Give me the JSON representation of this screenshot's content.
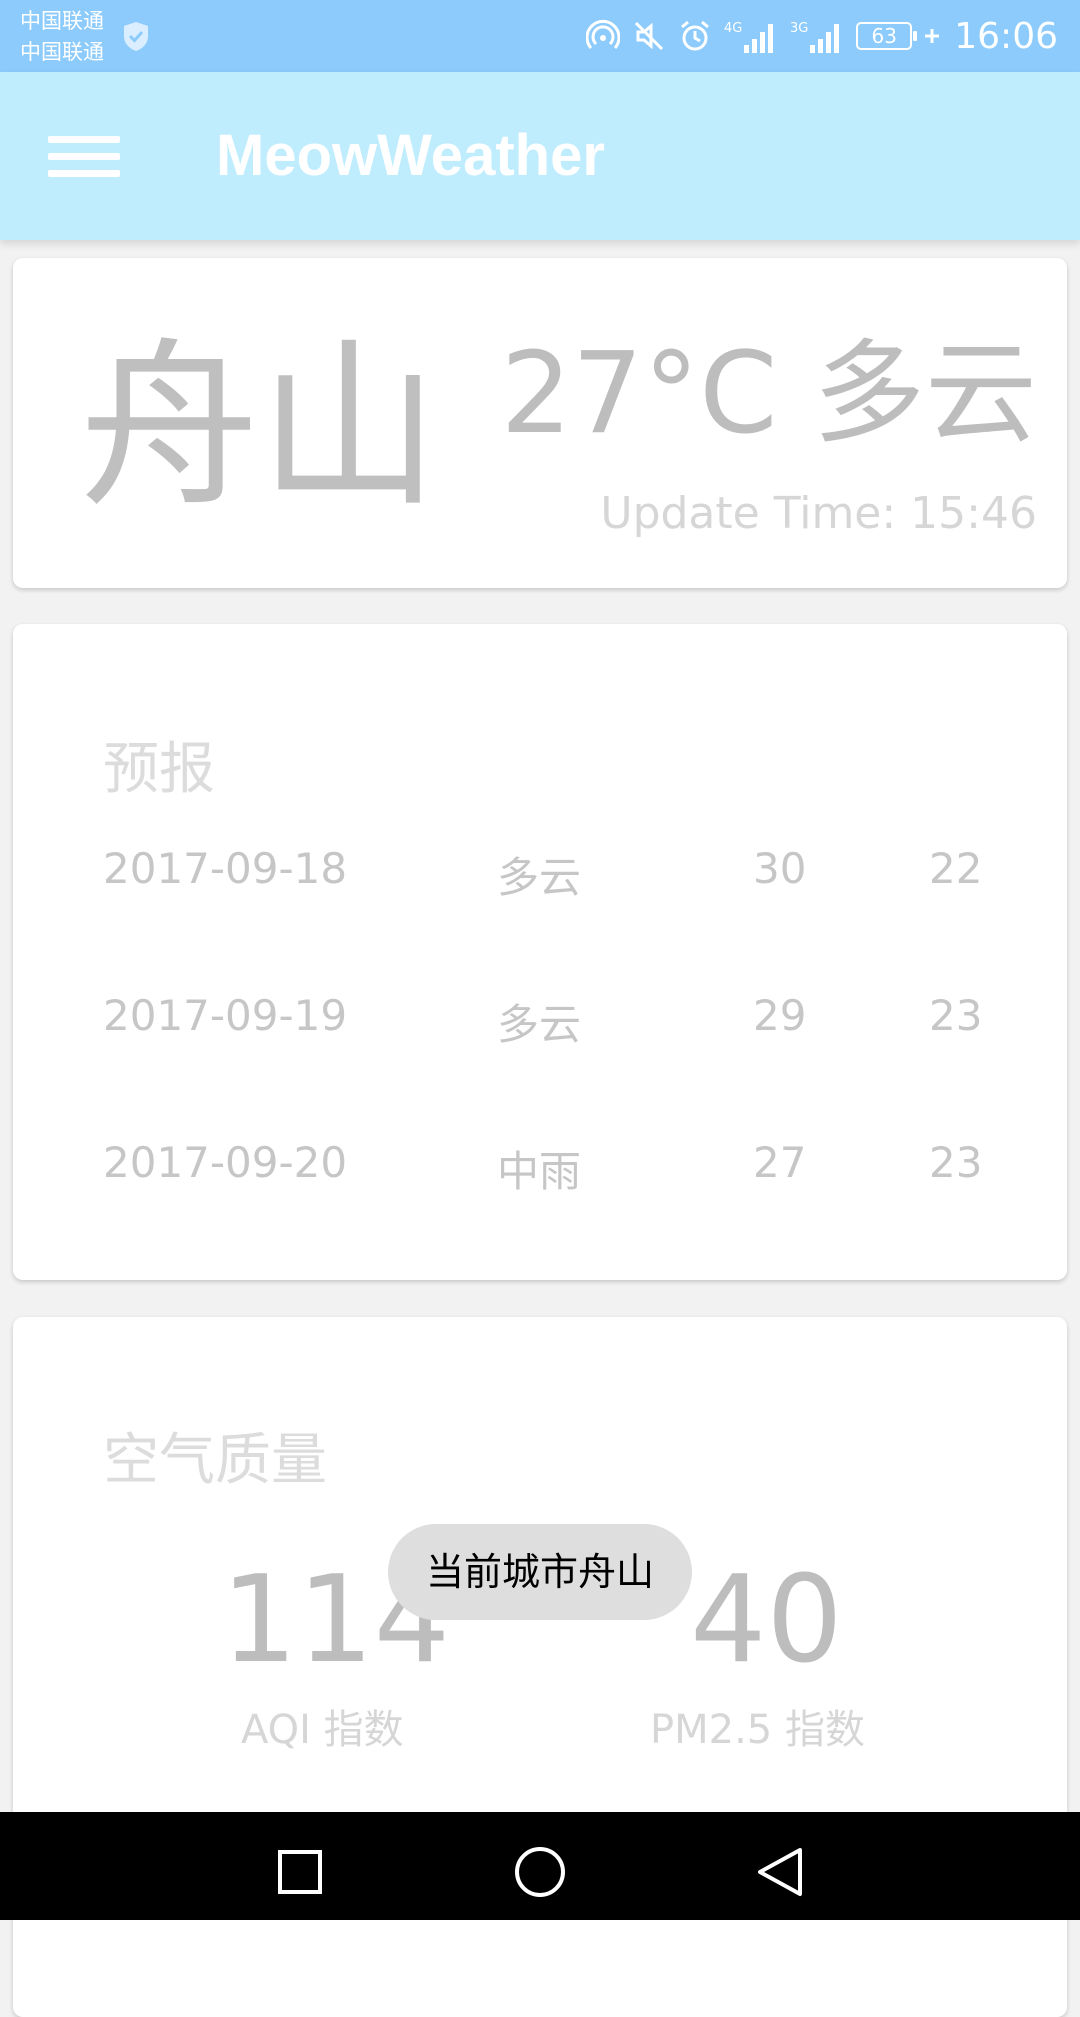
{
  "status_bar": {
    "carrier_1": "中国联通",
    "carrier_2": "中国联通",
    "network_1": "4G",
    "network_2": "3G",
    "battery": "63",
    "time": "16:06"
  },
  "app_bar": {
    "title": "MeowWeather",
    "menu_icon": "menu-icon"
  },
  "current": {
    "city": "舟山",
    "temperature": "27°C",
    "condition": "多云",
    "update_time": "Update Time: 15:46"
  },
  "forecast": {
    "title": "预报",
    "rows": [
      {
        "date": "2017-09-18",
        "condition": "多云",
        "max": "30",
        "min": "22"
      },
      {
        "date": "2017-09-19",
        "condition": "多云",
        "max": "29",
        "min": "23"
      },
      {
        "date": "2017-09-20",
        "condition": "中雨",
        "max": "27",
        "min": "23"
      }
    ]
  },
  "air_quality": {
    "title": "空气质量",
    "aqi_value": "114",
    "aqi_label": "AQI 指数",
    "pm25_value": "40",
    "pm25_label": "PM2.5 指数"
  },
  "toast": "当前城市舟山",
  "nav": {
    "recents": "square-icon",
    "home": "circle-icon",
    "back": "triangle-back-icon"
  }
}
